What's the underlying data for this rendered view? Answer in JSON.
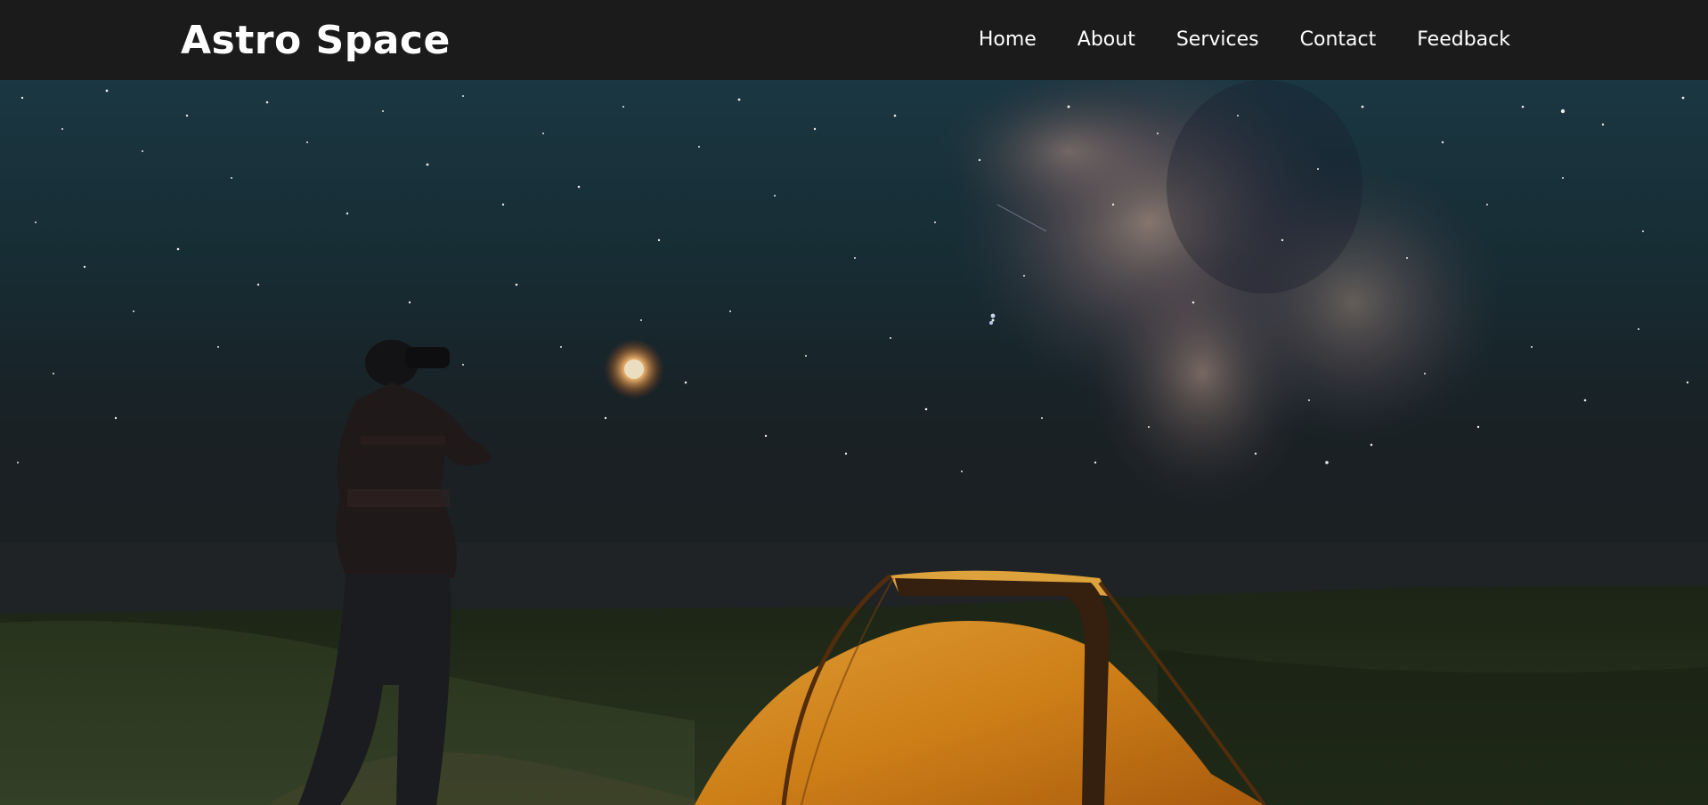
{
  "header": {
    "brand": "Astro Space",
    "nav": [
      {
        "label": "Home"
      },
      {
        "label": "About"
      },
      {
        "label": "Services"
      },
      {
        "label": "Contact"
      },
      {
        "label": "Feedback"
      }
    ]
  },
  "hero": {
    "image_subject": "night-sky-camping-scene"
  },
  "colors": {
    "navbar_bg": "#1b1b1b",
    "nav_text": "#ffffff",
    "tent_orange": "#e8901c",
    "sky_top": "#1c3a44",
    "ground": "#1e2a18"
  }
}
